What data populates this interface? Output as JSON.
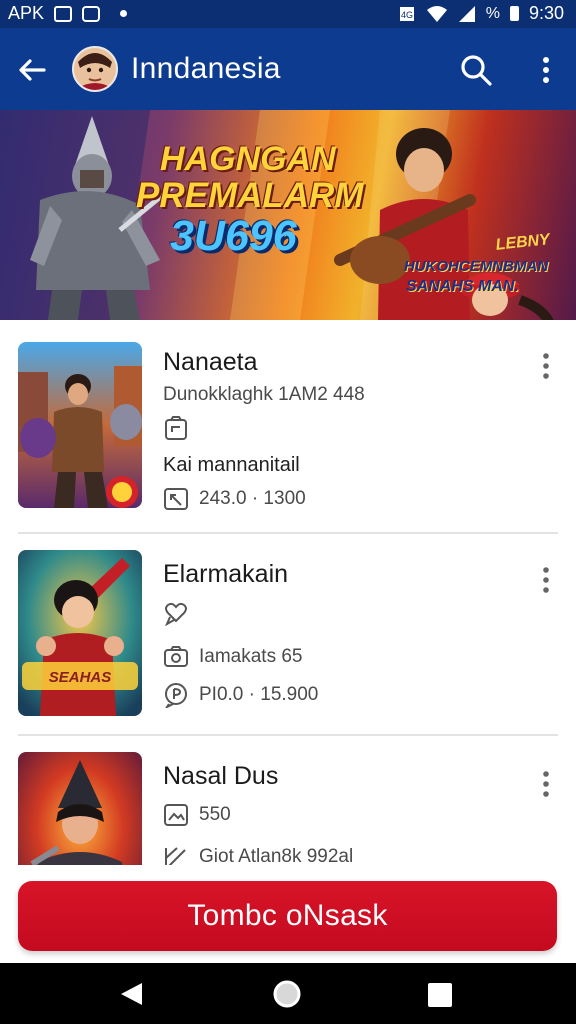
{
  "status_bar": {
    "left_text": "APK",
    "left_icons": [
      "app-grid-icon",
      "notification-icon",
      "dot-icon"
    ],
    "percent": "%",
    "time": "9:30",
    "right_icons": [
      "data-icon",
      "wifi-icon",
      "signal-icon",
      "battery-icon"
    ]
  },
  "app_bar": {
    "title": "Inndanesia",
    "icons": [
      "back-arrow-icon",
      "avatar",
      "search-icon",
      "more-vert-icon"
    ]
  },
  "banner": {
    "line1": "HAGNGAN",
    "line2": "PREMALARM",
    "code": "3U696",
    "badge": "LEBNY",
    "sub1": "HUKOHCEMNBMAN",
    "sub2": "SANAHS MAN."
  },
  "items": [
    {
      "title": "Nanaeta",
      "line1": "Dunokklaghk 1AM2 448",
      "line2_icon": "clipboard-icon",
      "line3": "Kai mannanitail",
      "line4_icon": "tag-icon",
      "line4": "243.0 · 1300",
      "menu_icon": "more-vert-icon"
    },
    {
      "title": "Elarmakain",
      "line1_icon": "heart-chat-icon",
      "line2_icon": "camera-icon",
      "line2": "Iamakats 65",
      "line3_icon": "price-icon",
      "line3": "PI0.0 · 15.900",
      "menu_icon": "more-vert-icon"
    },
    {
      "title": "Nasal Dus",
      "line1_icon": "image-icon",
      "line1": "550",
      "line2_icon": "edit-icon",
      "line2": "Giot Atlan8k 992al",
      "menu_icon": "more-vert-icon"
    }
  ],
  "cta": {
    "label": "Tombc oNsask"
  },
  "nav": {
    "icons": [
      "back-triangle-icon",
      "home-circle-icon",
      "recents-square-icon"
    ]
  },
  "colors": {
    "app_bar": "#0d3b8f",
    "status_bar": "#0b2f72",
    "cta": "#cc1022",
    "nav": "#000000"
  }
}
